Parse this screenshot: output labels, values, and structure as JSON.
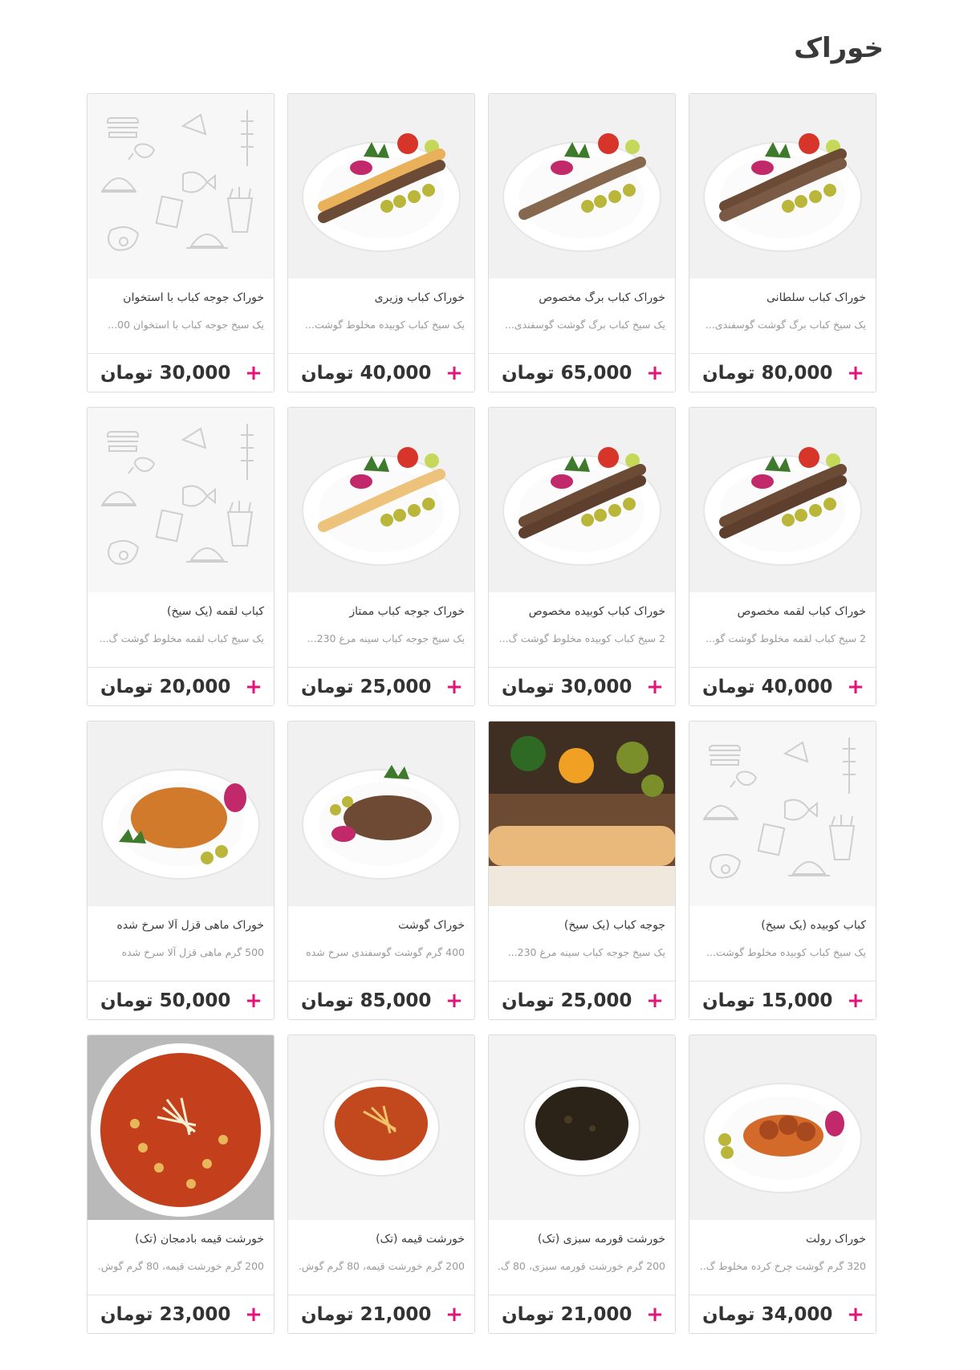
{
  "section": {
    "title": "خوراک"
  },
  "items": [
    {
      "name": "خوراک کباب سلطانی",
      "desc": "یک سیخ کباب برگ گوشت گوسفندی...",
      "price": "80,000 تومان",
      "add": "+",
      "image": "plate-barg-kubide"
    },
    {
      "name": "خوراک کباب برگ مخصوص",
      "desc": "یک سیخ کباب برگ گوشت گوسفندی...",
      "price": "65,000 تومان",
      "add": "+",
      "image": "plate-barg"
    },
    {
      "name": "خوراک کباب وزیری",
      "desc": "یک سیخ کباب کوبیده مخلوط گوشت...",
      "price": "40,000 تومان",
      "add": "+",
      "image": "plate-joojeh-kubide"
    },
    {
      "name": "خوراک جوجه کباب با استخوان",
      "desc": "یک سیخ جوجه کباب با استخوان 00...",
      "price": "30,000 تومان",
      "add": "+",
      "image": "placeholder"
    },
    {
      "name": "خوراک کباب لقمه مخصوص",
      "desc": "2 سیخ کباب لقمه مخلوط گوشت گو...",
      "price": "40,000 تومان",
      "add": "+",
      "image": "plate-kubide"
    },
    {
      "name": "خوراک کباب کوبیده مخصوص",
      "desc": "2 سیخ کباب کوبیده مخلوط گوشت گ...",
      "price": "30,000 تومان",
      "add": "+",
      "image": "plate-kubide"
    },
    {
      "name": "خوراک جوجه کباب ممتاز",
      "desc": "یک سیخ جوجه کباب سینه مرغ 230...",
      "price": "25,000 تومان",
      "add": "+",
      "image": "plate-joojeh"
    },
    {
      "name": "کباب لقمه (یک سیخ)",
      "desc": "یک سیخ کباب لقمه مخلوط گوشت گ...",
      "price": "20,000 تومان",
      "add": "+",
      "image": "placeholder"
    },
    {
      "name": "کباب کوبیده (یک سیخ)",
      "desc": "یک سیخ کباب کوبیده مخلوط گوشت...",
      "price": "15,000 تومان",
      "add": "+",
      "image": "placeholder"
    },
    {
      "name": "جوجه کباب (یک سیخ)",
      "desc": "یک سیخ جوجه کباب سینه مرغ 230...",
      "price": "25,000 تومان",
      "add": "+",
      "image": "photo-joojeh-closeup"
    },
    {
      "name": "خوراک گوشت",
      "desc": "400 گرم گوشت گوسفندی سرخ شده",
      "price": "85,000 تومان",
      "add": "+",
      "image": "plate-meat"
    },
    {
      "name": "خوراک ماهی قزل آلا سرخ شده",
      "desc": "500 گرم ماهی قزل آلا سرخ شده",
      "price": "50,000 تومان",
      "add": "+",
      "image": "plate-fish"
    },
    {
      "name": "خوراک رولت",
      "desc": "320 گرم گوشت چرخ کرده مخلوط گ...",
      "price": "34,000 تومان",
      "add": "+",
      "image": "plate-rolled"
    },
    {
      "name": "خورشت قورمه سبزی (تک)",
      "desc": "200 گرم خورشت قورمه سبزی، 80 گ...",
      "price": "21,000 تومان",
      "add": "+",
      "image": "bowl-ghormeh"
    },
    {
      "name": "خورشت قیمه (تک)",
      "desc": "200 گرم خورشت قیمه، 80 گرم گوش...",
      "price": "21,000 تومان",
      "add": "+",
      "image": "bowl-gheimeh"
    },
    {
      "name": "خورشت قیمه بادمجان (تک)",
      "desc": "200 گرم خورشت قیمه، 80 گرم گوش...",
      "price": "23,000 تومان",
      "add": "+",
      "image": "plate-gheimeh-bademjan"
    }
  ],
  "colors": {
    "accent": "#e2147a",
    "price": "#333333",
    "muted": "#9a9a9a",
    "border": "#dcdcdc",
    "placeholder_line": "#c9c9c9"
  }
}
